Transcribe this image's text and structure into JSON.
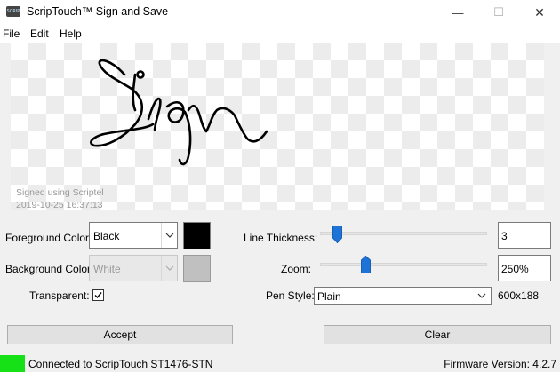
{
  "window": {
    "icon_text": "SCRIP",
    "title": "ScripTouch™ Sign and Save",
    "minimize_glyph": "—",
    "maximize_glyph": "☐",
    "close_glyph": "✕"
  },
  "menu": {
    "items": [
      "File",
      "Edit",
      "Help"
    ]
  },
  "canvas": {
    "caption_line1": "Signed using Scriptel",
    "caption_line2": "2019-10-25 16:37:13",
    "ink_color": "#000000"
  },
  "controls": {
    "foreground": {
      "label": "Foreground Color:",
      "value": "Black",
      "swatch": "#000000"
    },
    "background": {
      "label": "Background Color:",
      "value": "White",
      "swatch": "#c0c0c0"
    },
    "transparent": {
      "label": "Transparent:",
      "checked": true
    },
    "line_thickness": {
      "label": "Line Thickness:",
      "value": "3",
      "fraction": 0.1
    },
    "zoom": {
      "label": "Zoom:",
      "value": "250%",
      "fraction": 0.27
    },
    "pen_style": {
      "label": "Pen Style:",
      "value": "Plain"
    },
    "size_readout": "600x188"
  },
  "buttons": {
    "accept": "Accept",
    "clear": "Clear"
  },
  "status": {
    "led_color": "#16e016",
    "connection": "Connected to ScripTouch ST1476-STN",
    "firmware": "Firmware Version: 4.2.7"
  },
  "colors": {
    "slider_thumb": "#1e73d8",
    "accent": "#0078d7"
  },
  "icons": {
    "combo_arrow": "chevron-down-icon",
    "check": "checkmark-icon"
  }
}
